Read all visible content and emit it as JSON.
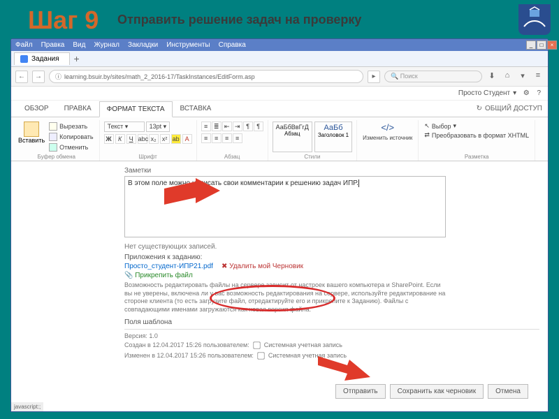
{
  "slide": {
    "title": "Шаг 9",
    "subtitle": "Отправить решение задач на проверку"
  },
  "browser": {
    "menu": [
      "Файл",
      "Правка",
      "Вид",
      "Журнал",
      "Закладки",
      "Инструменты",
      "Справка"
    ],
    "tab_title": "Задания",
    "url": "learning.bsuir.by/sites/math_2_2016-17/TaskInstances/EditForm.asp",
    "search_placeholder": "Поиск",
    "user": "Просто Студент"
  },
  "sp": {
    "tabs": [
      "ОБЗОР",
      "ПРАВКА",
      "ФОРМАТ ТЕКСТА",
      "ВСТАВКА"
    ],
    "share": "ОБЩИЙ ДОСТУП"
  },
  "ribbon": {
    "paste": "Вставить",
    "cut": "Вырезать",
    "copy": "Копировать",
    "undo": "Отменить",
    "clipboard_label": "Буфер обмена",
    "font_name": "Текст",
    "font_size": "13pt",
    "font_label": "Шрифт",
    "para_label": "Абзац",
    "style1_sample": "АаБбВвГгД",
    "style1_name": "Абзац",
    "style2_sample": "АаБб",
    "style2_name": "Заголовок 1",
    "styles_label": "Стили",
    "edit_source": "Изменить источник",
    "select": "Выбор",
    "tohtml": "Преобразовать в формат XHTML",
    "markup_label": "Разметка"
  },
  "content": {
    "notes_label": "Заметки",
    "notes_text": "В этом поле можно написать свои комментарии к решению задач ИПР.",
    "no_records": "Нет существующих записей.",
    "attachments_label": "Приложения к заданию:",
    "attachment_file": "Просто_студент-ИПР21.pdf",
    "delete_draft": "Удалить мой Черновик",
    "attach_file": "Прикрепить файл",
    "help_text": "Возможность редактировать файлы на сервере зависит от настроек вашего компьютера и SharePoint. Если вы не уверены, включена ли у вас возможность редактирования на сервере, используйте редактирование на стороне клиента (то есть загрузите файл, отредактируйте его и прикрепите к Заданию). Файлы с совпадающими именами загружаются как новая версия файла.",
    "template_label": "Поля шаблона",
    "version": "Версия: 1.0",
    "created": "Создан в 12.04.2017 15:26 пользователем:",
    "modified": "Изменен в 12.04.2017 15:26 пользователем:",
    "sys_account": "Системная учетная запись"
  },
  "buttons": {
    "send": "Отправить",
    "save_draft": "Сохранить как черновик",
    "cancel": "Отмена"
  },
  "status": "javascript:;"
}
